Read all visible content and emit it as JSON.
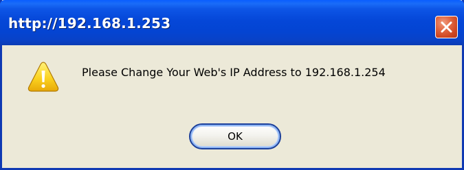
{
  "dialog": {
    "title": "http://192.168.1.253",
    "message": "Please Change Your Web's IP Address to 192.168.1.254",
    "icon": "warning-icon",
    "ok_label": "OK",
    "close_icon": "close-icon"
  },
  "colors": {
    "titlebar": "#0547d8",
    "close_button": "#d9532e",
    "dialog_background": "#ece9d8",
    "warning_yellow": "#f9c813",
    "ok_button_border": "#1b3f9a"
  }
}
